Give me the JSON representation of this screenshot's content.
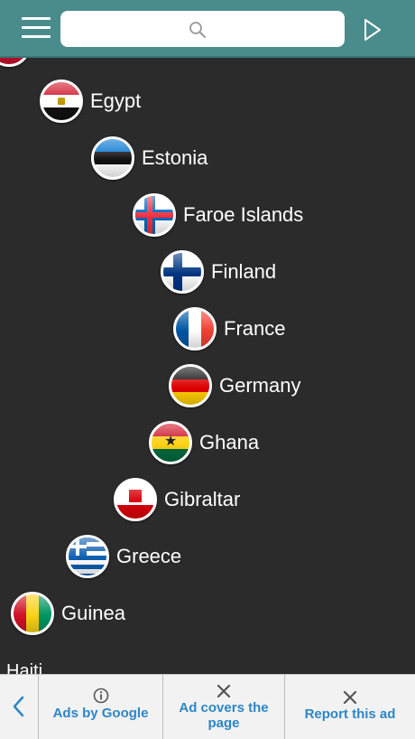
{
  "header": {
    "menu_icon": "hamburger-menu-icon",
    "search_icon": "search-icon",
    "play_icon": "play-icon",
    "bar_color": "#4a8c8c"
  },
  "countries": [
    {
      "name": "Egypt"
    },
    {
      "name": "Estonia"
    },
    {
      "name": "Faroe Islands"
    },
    {
      "name": "Finland"
    },
    {
      "name": "France"
    },
    {
      "name": "Germany"
    },
    {
      "name": "Ghana"
    },
    {
      "name": "Gibraltar"
    },
    {
      "name": "Greece"
    },
    {
      "name": "Guinea"
    }
  ],
  "partial_item": "Haiti",
  "adbar": {
    "back_icon": "chevron-left-icon",
    "ads_by_google": "Ads by Google",
    "ad_covers": "Ad covers the page",
    "report_ad": "Report this ad",
    "accent": "#2c86c6"
  }
}
